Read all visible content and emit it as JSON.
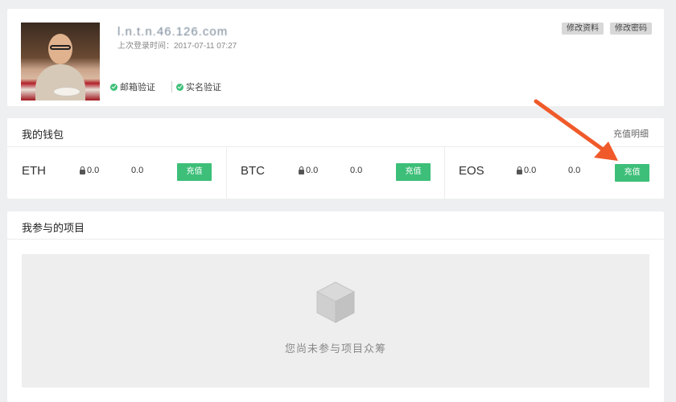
{
  "profile": {
    "username": "l.n.t.n.46.126.com",
    "last_login": "上次登录时间：2017-07-11 07:27",
    "email_verify": "邮箱验证",
    "realname_verify": "实名验证",
    "edit_profile": "修改资料",
    "change_password": "修改密码"
  },
  "wallet": {
    "title": "我的钱包",
    "detail_link": "充值明细",
    "coins": [
      {
        "name": "ETH",
        "locked": "0.0",
        "balance": "0.0",
        "action": "充值"
      },
      {
        "name": "BTC",
        "locked": "0.0",
        "balance": "0.0",
        "action": "充值"
      },
      {
        "name": "EOS",
        "locked": "0.0",
        "balance": "0.0",
        "action": "充值"
      }
    ]
  },
  "projects": {
    "title": "我参与的项目",
    "empty_text": "您尚未参与项目众筹"
  },
  "colors": {
    "accent_green": "#3dbf79",
    "annotation_arrow": "#f05a2a"
  },
  "icons": {
    "empty_state": "cube-icon",
    "verified": "check-circle-icon",
    "locked": "lock-icon"
  }
}
